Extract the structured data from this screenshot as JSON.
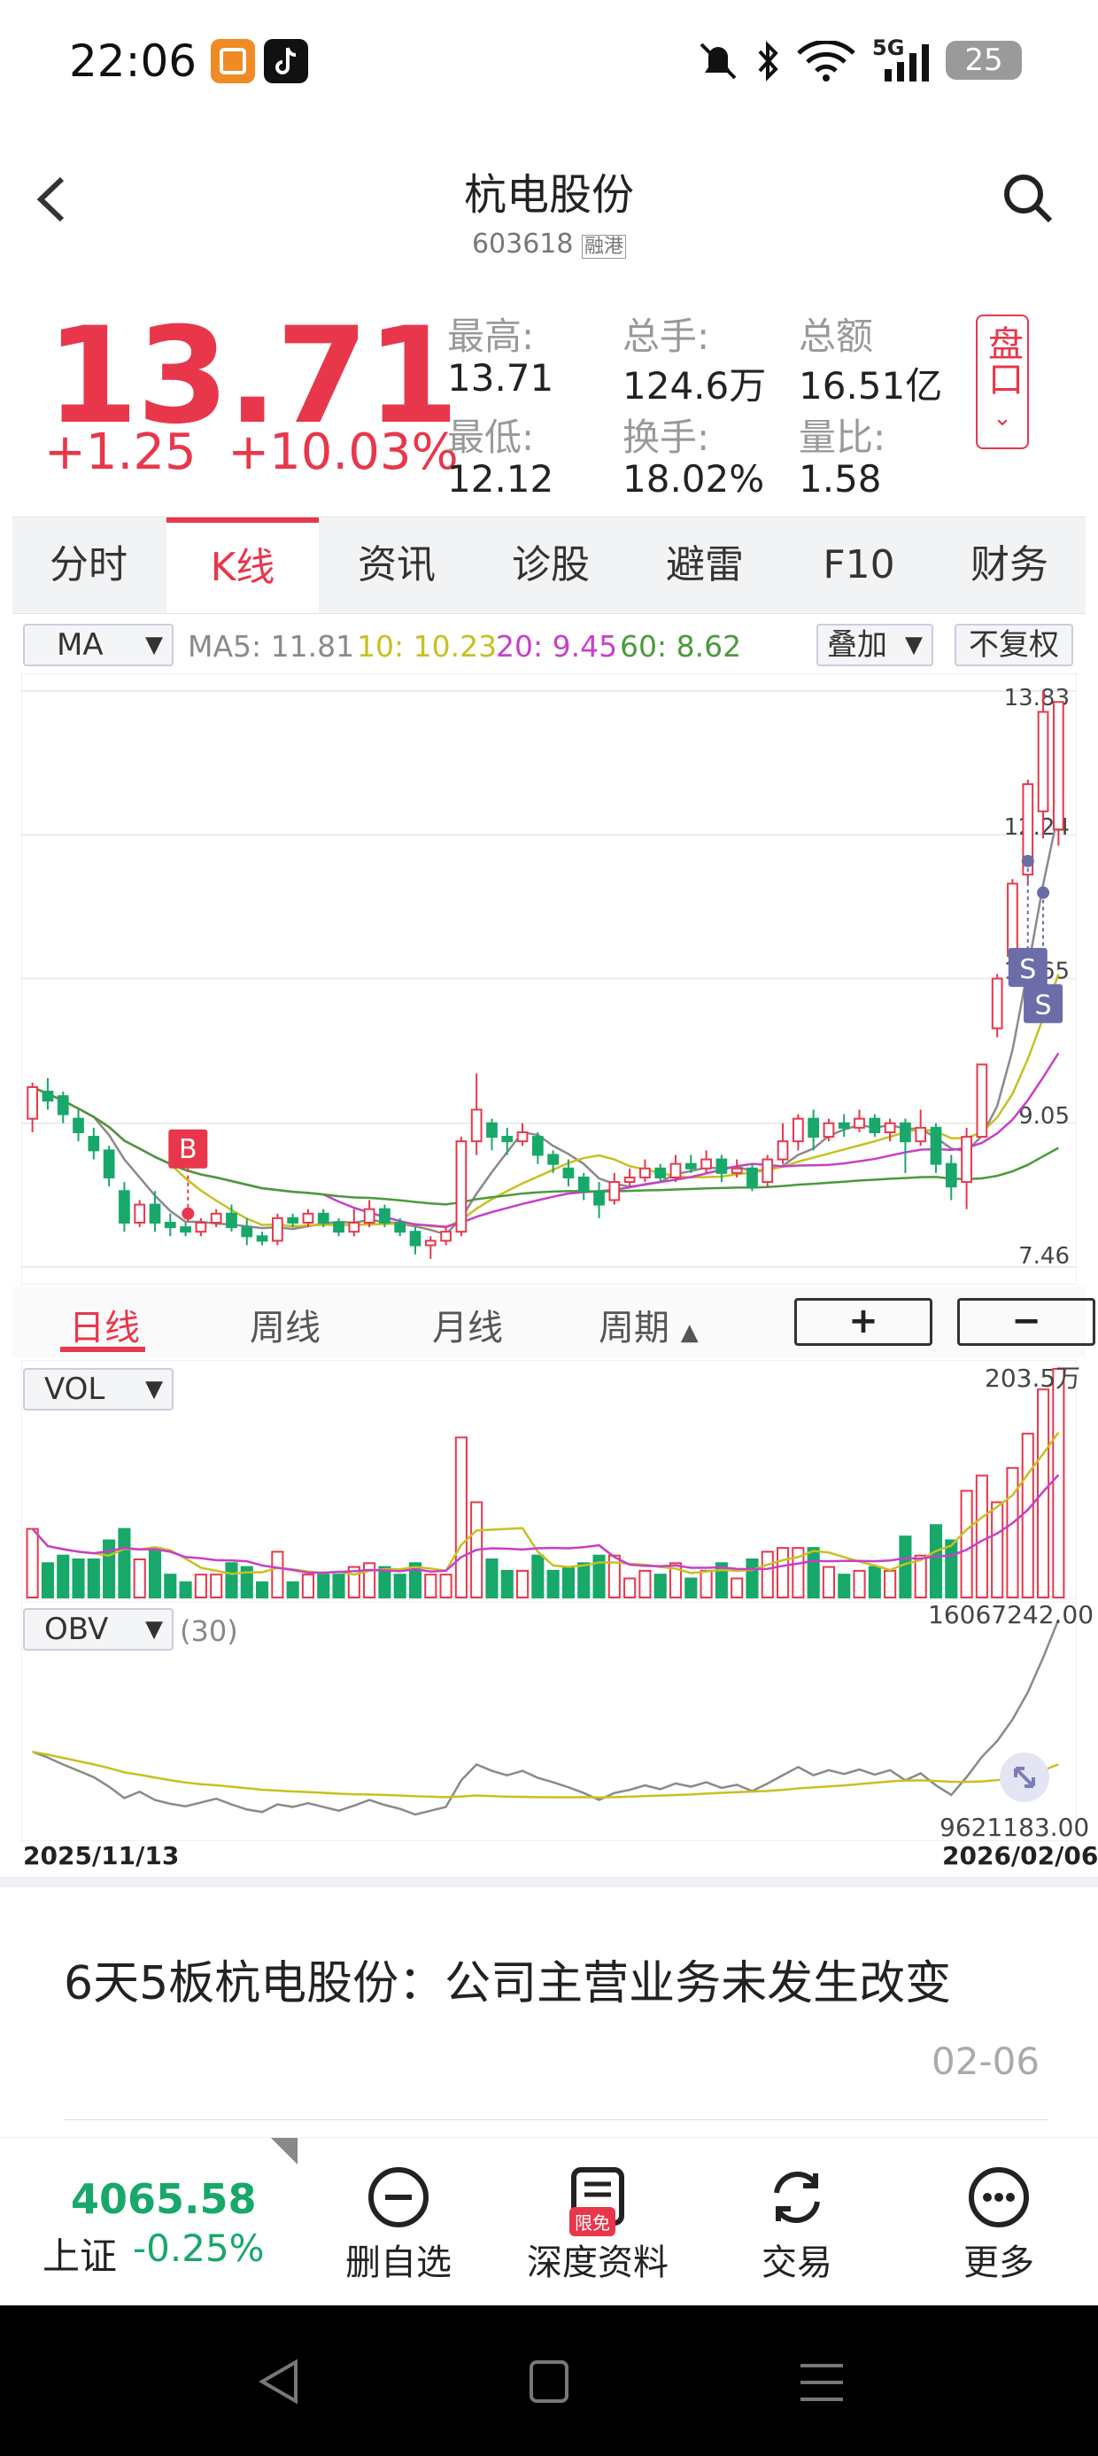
{
  "status_bar": {
    "time": "22:06",
    "signal_label": "5G",
    "battery": "25",
    "icons": [
      "app-badge-icon",
      "tiktok-icon",
      "mute-bell-icon",
      "bluetooth-icon",
      "wifi-icon",
      "signal-icon",
      "battery-icon"
    ]
  },
  "header": {
    "title": "杭电股份",
    "code": "603618",
    "tags": "融港"
  },
  "quote": {
    "price": "13.71",
    "change": "+1.25",
    "change_pct": "+10.03%",
    "high_label": "最高:",
    "high": "13.71",
    "low_label": "最低:",
    "low": "12.12",
    "volume_label": "总手:",
    "volume": "124.6万",
    "turnover_label": "换手:",
    "turnover": "18.02%",
    "amount_label": "总额",
    "amount": "16.51亿",
    "ratio_label": "量比:",
    "ratio": "1.58",
    "pankou": "盘口"
  },
  "tabs": [
    "分时",
    "K线",
    "资讯",
    "诊股",
    "避雷",
    "F10",
    "财务"
  ],
  "active_tab": "K线",
  "indicator_bar": {
    "selector": "MA",
    "ma5": "MA5: 11.81",
    "ma10": "10: 10.23",
    "ma20": "20: 9.45",
    "ma60": "60: 8.62",
    "overlay": "叠加",
    "adjust": "不复权"
  },
  "colors": {
    "up": "#e8374b",
    "down": "#17a86a",
    "ma5": "#8a8a8a",
    "ma10": "#c8c020",
    "ma20": "#c83fc8",
    "ma60": "#4a9a3a",
    "marker": "#6c6ca8"
  },
  "chart_data": {
    "type": "candlestick",
    "y_axis_labels": [
      "13.83",
      "12.24",
      "10.65",
      "9.05",
      "7.46"
    ],
    "ylim": [
      7.46,
      13.83
    ],
    "x_start": "2025/11/13",
    "x_end": "2026/02/06",
    "markers": [
      {
        "label": "B"
      },
      {
        "label": "S"
      },
      {
        "label": "S"
      }
    ],
    "candles": [
      {
        "o": 9.1,
        "c": 9.45,
        "h": 9.5,
        "l": 8.95
      },
      {
        "o": 9.4,
        "c": 9.3,
        "h": 9.55,
        "l": 9.2
      },
      {
        "o": 9.35,
        "c": 9.15,
        "h": 9.4,
        "l": 9.05
      },
      {
        "o": 9.1,
        "c": 8.95,
        "h": 9.2,
        "l": 8.85
      },
      {
        "o": 8.9,
        "c": 8.75,
        "h": 9.0,
        "l": 8.65
      },
      {
        "o": 8.75,
        "c": 8.45,
        "h": 8.8,
        "l": 8.35
      },
      {
        "o": 8.3,
        "c": 7.95,
        "h": 8.4,
        "l": 7.85
      },
      {
        "o": 7.95,
        "c": 8.15,
        "h": 8.2,
        "l": 7.9
      },
      {
        "o": 8.15,
        "c": 7.95,
        "h": 8.3,
        "l": 7.85
      },
      {
        "o": 7.95,
        "c": 7.9,
        "h": 8.05,
        "l": 7.8
      },
      {
        "o": 7.9,
        "c": 7.85,
        "h": 7.95,
        "l": 7.8
      },
      {
        "o": 7.85,
        "c": 7.95,
        "h": 8.0,
        "l": 7.8
      },
      {
        "o": 7.95,
        "c": 8.05,
        "h": 8.1,
        "l": 7.9
      },
      {
        "o": 8.05,
        "c": 7.9,
        "h": 8.15,
        "l": 7.85
      },
      {
        "o": 7.9,
        "c": 7.8,
        "h": 8.0,
        "l": 7.7
      },
      {
        "o": 7.8,
        "c": 7.75,
        "h": 7.85,
        "l": 7.7
      },
      {
        "o": 7.75,
        "c": 8.0,
        "h": 8.05,
        "l": 7.7
      },
      {
        "o": 8.0,
        "c": 7.95,
        "h": 8.05,
        "l": 7.9
      },
      {
        "o": 7.95,
        "c": 8.05,
        "h": 8.1,
        "l": 7.9
      },
      {
        "o": 8.05,
        "c": 7.95,
        "h": 8.1,
        "l": 7.9
      },
      {
        "o": 7.95,
        "c": 7.85,
        "h": 8.0,
        "l": 7.8
      },
      {
        "o": 7.85,
        "c": 7.95,
        "h": 8.1,
        "l": 7.8
      },
      {
        "o": 7.95,
        "c": 8.1,
        "h": 8.2,
        "l": 7.9
      },
      {
        "o": 8.1,
        "c": 7.95,
        "h": 8.15,
        "l": 7.9
      },
      {
        "o": 7.95,
        "c": 7.85,
        "h": 8.0,
        "l": 7.8
      },
      {
        "o": 7.85,
        "c": 7.7,
        "h": 7.9,
        "l": 7.6
      },
      {
        "o": 7.7,
        "c": 7.75,
        "h": 7.8,
        "l": 7.55
      },
      {
        "o": 7.75,
        "c": 7.85,
        "h": 7.9,
        "l": 7.7
      },
      {
        "o": 7.85,
        "c": 8.85,
        "h": 8.9,
        "l": 7.8
      },
      {
        "o": 8.85,
        "c": 9.2,
        "h": 9.6,
        "l": 8.7
      },
      {
        "o": 9.05,
        "c": 8.9,
        "h": 9.1,
        "l": 8.75
      },
      {
        "o": 8.9,
        "c": 8.85,
        "h": 9.0,
        "l": 8.7
      },
      {
        "o": 8.85,
        "c": 8.95,
        "h": 9.05,
        "l": 8.8
      },
      {
        "o": 8.9,
        "c": 8.7,
        "h": 8.95,
        "l": 8.6
      },
      {
        "o": 8.7,
        "c": 8.6,
        "h": 8.75,
        "l": 8.5
      },
      {
        "o": 8.55,
        "c": 8.45,
        "h": 8.65,
        "l": 8.35
      },
      {
        "o": 8.45,
        "c": 8.3,
        "h": 8.5,
        "l": 8.2
      },
      {
        "o": 8.3,
        "c": 8.15,
        "h": 8.4,
        "l": 8.0
      },
      {
        "o": 8.2,
        "c": 8.4,
        "h": 8.5,
        "l": 8.15
      },
      {
        "o": 8.4,
        "c": 8.45,
        "h": 8.55,
        "l": 8.35
      },
      {
        "o": 8.45,
        "c": 8.55,
        "h": 8.65,
        "l": 8.4
      },
      {
        "o": 8.55,
        "c": 8.45,
        "h": 8.6,
        "l": 8.4
      },
      {
        "o": 8.45,
        "c": 8.6,
        "h": 8.7,
        "l": 8.4
      },
      {
        "o": 8.6,
        "c": 8.55,
        "h": 8.7,
        "l": 8.5
      },
      {
        "o": 8.55,
        "c": 8.65,
        "h": 8.75,
        "l": 8.5
      },
      {
        "o": 8.65,
        "c": 8.5,
        "h": 8.7,
        "l": 8.4
      },
      {
        "o": 8.5,
        "c": 8.55,
        "h": 8.65,
        "l": 8.45
      },
      {
        "o": 8.55,
        "c": 8.35,
        "h": 8.6,
        "l": 8.3
      },
      {
        "o": 8.4,
        "c": 8.65,
        "h": 8.7,
        "l": 8.35
      },
      {
        "o": 8.65,
        "c": 8.85,
        "h": 9.05,
        "l": 8.6
      },
      {
        "o": 8.85,
        "c": 9.1,
        "h": 9.15,
        "l": 8.75
      },
      {
        "o": 9.1,
        "c": 8.9,
        "h": 9.2,
        "l": 8.75
      },
      {
        "o": 8.9,
        "c": 9.05,
        "h": 9.1,
        "l": 8.85
      },
      {
        "o": 9.05,
        "c": 9.0,
        "h": 9.15,
        "l": 8.9
      },
      {
        "o": 9.0,
        "c": 9.1,
        "h": 9.2,
        "l": 8.95
      },
      {
        "o": 9.1,
        "c": 8.95,
        "h": 9.15,
        "l": 8.9
      },
      {
        "o": 8.95,
        "c": 9.05,
        "h": 9.1,
        "l": 8.85
      },
      {
        "o": 9.05,
        "c": 8.85,
        "h": 9.1,
        "l": 8.5
      },
      {
        "o": 8.85,
        "c": 9.0,
        "h": 9.2,
        "l": 8.8
      },
      {
        "o": 9.0,
        "c": 8.6,
        "h": 9.05,
        "l": 8.5
      },
      {
        "o": 8.6,
        "c": 8.35,
        "h": 8.7,
        "l": 8.2
      },
      {
        "o": 8.4,
        "c": 8.9,
        "h": 9.0,
        "l": 8.1
      },
      {
        "o": 8.9,
        "c": 9.7,
        "h": 9.7,
        "l": 8.9
      },
      {
        "o": 10.1,
        "c": 10.65,
        "h": 10.7,
        "l": 10.0
      },
      {
        "o": 10.9,
        "c": 11.7,
        "h": 11.75,
        "l": 10.85
      },
      {
        "o": 11.8,
        "c": 12.8,
        "h": 12.85,
        "l": 11.7
      },
      {
        "o": 12.5,
        "c": 13.6,
        "h": 13.83,
        "l": 12.2
      },
      {
        "o": 12.3,
        "c": 13.71,
        "h": 13.71,
        "l": 12.12
      }
    ]
  },
  "period_tabs": [
    "日线",
    "周线",
    "月线",
    "周期"
  ],
  "zoom_in": "+",
  "zoom_out": "−",
  "vol": {
    "selector": "VOL",
    "max_label": "203.5万"
  },
  "obv": {
    "selector": "OBV",
    "param": "(30)",
    "max_label": "16067242.00",
    "min_label": "9621183.00"
  },
  "news": {
    "title": "6天5板杭电股份：公司主营业务未发生改变",
    "date": "02-06"
  },
  "bottom_bar": {
    "index_value": "4065.58",
    "index_name": "上证",
    "index_change": "-0.25%",
    "buttons": [
      "删自选",
      "深度资料",
      "交易",
      "更多"
    ],
    "free_badge": "限免"
  }
}
